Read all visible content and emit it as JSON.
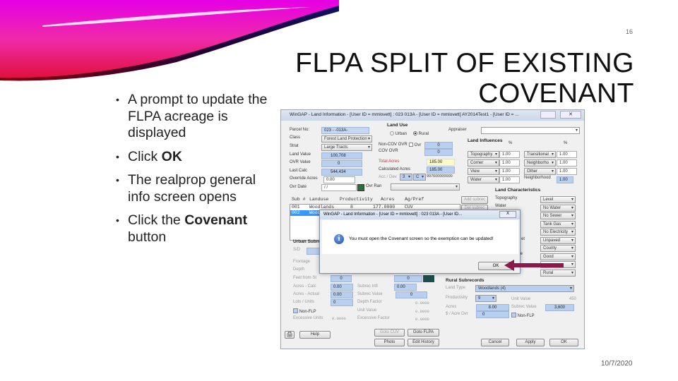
{
  "slide": {
    "page_number": "16",
    "title_line1": "FLPA SPLIT OF EXISTING",
    "title_line2": "COVENANT",
    "date": "10/7/2020",
    "bullets": [
      {
        "text": "A prompt to update the FLPA acreage is displayed"
      },
      {
        "pre": "Click ",
        "bold": "OK"
      },
      {
        "text": "The realprop general info screen opens"
      },
      {
        "pre": "Click the ",
        "bold": "Covenant",
        "post": " button"
      }
    ],
    "colors": {
      "arrow": "#8b1a4a",
      "swoosh_magenta": "#e600e6",
      "swoosh_red": "#e0103a",
      "swoosh_navy": "#101060"
    }
  },
  "window": {
    "title": "WinGAP - Land Information - [User ID = mmlovett] : 023    013A         - [User ID = mmlovett] AY2014Test1 - [User ID = ...",
    "left": {
      "parcel_label": "Parcel No:",
      "parcel": "023 -  -013A-",
      "class_label": "Class",
      "class": "Forest Land Protection",
      "strat_label": "Strat",
      "strat": "Large Tracts",
      "land_value_label": "Land Value",
      "land_value": "100,708",
      "ovr_value_label": "OVR Value",
      "ovr_value": "0",
      "last_calc_label": "Last Calc",
      "last_calc": "544,434",
      "override_acres_label": "Override Acres",
      "override_acres": "0.00",
      "ovr_date_label": "Ovr Date",
      "ovr_date": "/ /"
    },
    "land_use": {
      "title": "Land Use",
      "urban": "Urban",
      "rural": "Rural",
      "selected": "Rural"
    },
    "appraiser_label": "Appraiser",
    "appraiser": "",
    "mid": {
      "noncov_label": "Non-COV OVR",
      "ovr_check": "Ovr",
      "noncov": "0",
      "cov_label": "COV OVR",
      "cov": "0",
      "total_label": "Total Acres",
      "total": "185.00",
      "calc_label": "Calculated Acres",
      "calc": "185.00",
      "accdev_label": "Acc / Dev",
      "acc": "3",
      "dev": "C",
      "code": "997600000000",
      "ovr_ran_label": "Ovr Ran",
      "ovr_ran": ""
    },
    "influences": {
      "title": "Land Influences",
      "pct": "%",
      "left": [
        {
          "name": "Topography",
          "v": "1.00"
        },
        {
          "name": "Corner",
          "v": "1.00"
        },
        {
          "name": "View",
          "v": "1.00"
        },
        {
          "name": "Water",
          "v": "1.00"
        }
      ],
      "right": [
        {
          "name": "Transitional",
          "v": "1.00"
        },
        {
          "name": "Neighborho",
          "v": "1.00"
        },
        {
          "name": "Other",
          "v": "1.00"
        }
      ],
      "neighborhood_label": "Neighborhood",
      "neighborhood": "1.00"
    },
    "characteristics": {
      "title": "Land Characteristics",
      "topography_label": "Topography",
      "water_label": "Water",
      "values": [
        "Level",
        "No Water",
        "No Sewer",
        "Tank Gas",
        "No Electricity",
        "Unpaved",
        "County",
        "Good",
        "",
        "Rural"
      ],
      "street_label": "et",
      "drainage_label": "age"
    },
    "subrecs": {
      "headers": [
        "Sub #",
        "Landuse",
        "Productivity",
        "Acres",
        "Ag/Pref"
      ],
      "rows": [
        [
          "001",
          "Woodlands",
          "8",
          "177.0000",
          "CUV"
        ],
        [
          "002",
          "Wood",
          "",
          "",
          ""
        ]
      ],
      "add": "Add subrec",
      "del": "Del subrec"
    },
    "urban": {
      "title": "Urban Subrecords",
      "sd": "S/D",
      "frontage": "Frontage",
      "depth": "Depth",
      "feet": "Feet from St",
      "feet_v": "0",
      "acres_calc": "Acres - Calc",
      "acres_calc_v": "0.00",
      "acres_actual": "Acres - Actual",
      "acres_actual_v": "0.00",
      "lots": "Lots / Units",
      "lots_v": "0",
      "nonflp": "Non-FLP",
      "excessive_units": "Excessive Units",
      "excessive_units_v": "0.0000",
      "infl_v_top": "0",
      "subrec_infl": "Subrec Infl",
      "subrec_infl_v": "0.00",
      "subrec_value": "Subrec Value",
      "subrec_value_v": "0",
      "depth_factor": "Depth Factor",
      "depth_factor_v": "0.0000",
      "unit_value": "Unit Value",
      "unit_value_v": "0.0000",
      "excessive_factor": "Excessive Factor",
      "excessive_factor_v": "0.0000"
    },
    "rural": {
      "title": "Rural Subrecords",
      "land_type_label": "Land Type",
      "land_type": "Woodlands       (4)",
      "productivity_label": "Productivity",
      "productivity": "9",
      "unit_value_label": "Unit Value",
      "unit_value": "450",
      "acres_label": "Acres",
      "acres": "8.00",
      "subrec_value_label": "Subrec Value",
      "subrec_value": "3,600",
      "acre_ovr_label": "$ / Acre Ovr",
      "acre_ovr": "0",
      "nonflp": "Non-FLP"
    },
    "buttons": {
      "help": "Help",
      "goto_cuv": "Goto CUV",
      "goto_flpa": "Goto FLPA",
      "photo": "Photo",
      "edit_history": "Edit History",
      "cancel": "Cancel",
      "apply": "Apply",
      "ok": "OK"
    }
  },
  "dialog": {
    "title": "WinGAP - Land Information - [User ID = mmlovett] : 023    013A      - [User ID...",
    "message": "You must open the Covenant screen so the exemption can be updated!",
    "ok": "OK",
    "close": "X"
  }
}
